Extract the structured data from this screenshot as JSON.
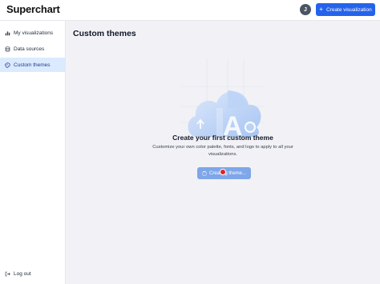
{
  "header": {
    "logo": "Superchart",
    "avatar_initial": "J",
    "create_button_label": "Create visualization",
    "create_button_icon": "plus-icon"
  },
  "sidebar": {
    "items": [
      {
        "label": "My visualizations",
        "icon": "chart-icon",
        "active": false
      },
      {
        "label": "Data sources",
        "icon": "database-icon",
        "active": false
      },
      {
        "label": "Custom themes",
        "icon": "palette-icon",
        "active": true
      }
    ],
    "logout_label": "Log out"
  },
  "main": {
    "title": "Custom themes",
    "empty_state": {
      "title": "Create your first custom theme",
      "description": "Customize your own color palette, fonts, and logo to apply to all your visualizations.",
      "button_label": "Creating theme..."
    }
  },
  "colors": {
    "accent": "#2563eb",
    "active_nav_bg": "#dbeafe",
    "main_bg": "#f2f2f6",
    "button_loading": "#7fa6e8",
    "cursor": "#dc2626"
  }
}
